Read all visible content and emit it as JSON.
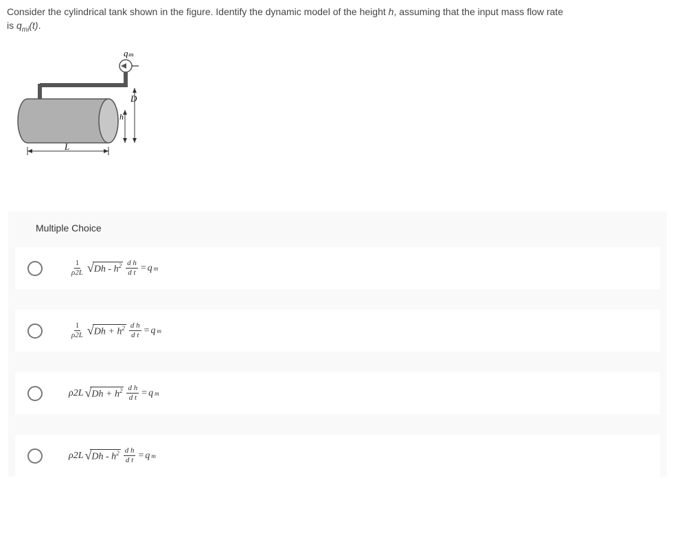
{
  "question": {
    "line1_prefix": "Consider the cylindrical tank shown in the figure. Identify the dynamic model of the height ",
    "h_var": "h",
    "line1_suffix": ", assuming that the input mass flow rate",
    "line2_prefix": "is ",
    "q_var": "q",
    "q_sub": "mi",
    "q_arg": "(t)",
    "line2_suffix": "."
  },
  "figure": {
    "qm": "qₘ",
    "D": "D",
    "h": "h",
    "L": "L"
  },
  "mc_title": "Multiple Choice",
  "options": [
    {
      "coeff_num": "1",
      "coeff_den": "ρ2L",
      "uses_frac_coeff": true,
      "inside": "Dh - h",
      "dh_num": "d h",
      "dh_den": "d t",
      "eq": " = ",
      "rhs": "q",
      "rhs_sub": "m"
    },
    {
      "coeff_num": "1",
      "coeff_den": "ρ2L",
      "uses_frac_coeff": true,
      "inside": "Dh + h",
      "dh_num": "d h",
      "dh_den": "d t",
      "eq": " = ",
      "rhs": "q",
      "rhs_sub": "m"
    },
    {
      "coeff": "ρ2L",
      "uses_frac_coeff": false,
      "inside": "Dh + h",
      "dh_num": "d h",
      "dh_den": "d t",
      "eq": " = ",
      "rhs": "q",
      "rhs_sub": "m"
    },
    {
      "coeff": "ρ2L",
      "uses_frac_coeff": false,
      "inside": "Dh - h",
      "dh_num": "d h",
      "dh_den": "d t",
      "eq": " = ",
      "rhs": "q",
      "rhs_sub": "m"
    }
  ]
}
